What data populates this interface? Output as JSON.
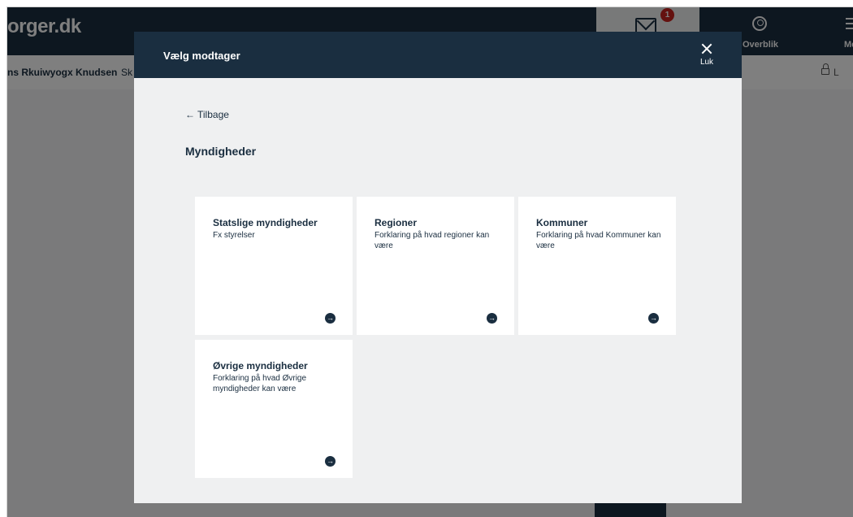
{
  "header": {
    "logo_text": "orger.dk",
    "mail_badge_count": "1",
    "overblik_label": "Overblik",
    "menu_label": "Me"
  },
  "subheader": {
    "user_name": "ns Rkuiwyogx Knudsen",
    "user_extra": "Sk",
    "lock_label": "L"
  },
  "modal": {
    "title": "Vælg modtager",
    "close_label": "Luk",
    "back_label": "Tilbage",
    "section_title": "Myndigheder",
    "cards": [
      {
        "title": "Statslige myndigheder",
        "description": "Fx styrelser"
      },
      {
        "title": "Regioner",
        "description": "Forklaring på hvad regioner kan være"
      },
      {
        "title": "Kommuner",
        "description": "Forklaring på hvad Kommuner kan være"
      },
      {
        "title": "Øvrige myndigheder",
        "description": "Forklaring på hvad Øvrige myndigheder kan være"
      }
    ]
  },
  "colors": {
    "navy": "#1a2e40",
    "badge_red": "#c8221e",
    "modal_bg": "#eff0f1",
    "card_bg": "#ffffff"
  },
  "icons": [
    "mail-icon",
    "profile-icon",
    "menu-icon",
    "lock-icon",
    "close-icon",
    "arrow-left-icon",
    "arrow-right-circle-icon"
  ]
}
